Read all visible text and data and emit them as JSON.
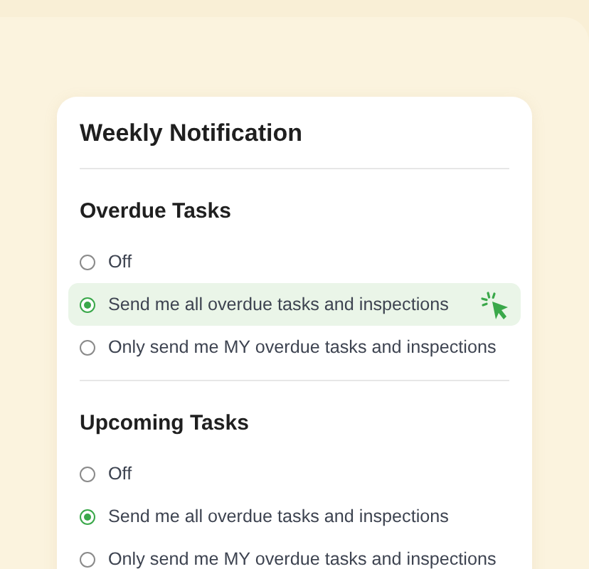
{
  "card": {
    "title": "Weekly Notification"
  },
  "sections": [
    {
      "heading": "Overdue Tasks",
      "options": [
        {
          "label": "Off",
          "selected": false,
          "highlighted": false
        },
        {
          "label": "Send me all overdue tasks and inspections",
          "selected": true,
          "highlighted": true
        },
        {
          "label": "Only send me MY overdue tasks and inspections",
          "selected": false,
          "highlighted": false
        }
      ]
    },
    {
      "heading": "Upcoming Tasks",
      "options": [
        {
          "label": "Off",
          "selected": false,
          "highlighted": false
        },
        {
          "label": "Send me all overdue tasks and inspections",
          "selected": true,
          "highlighted": false
        },
        {
          "label": "Only send me MY overdue tasks and inspections",
          "selected": false,
          "highlighted": false
        }
      ]
    }
  ]
}
